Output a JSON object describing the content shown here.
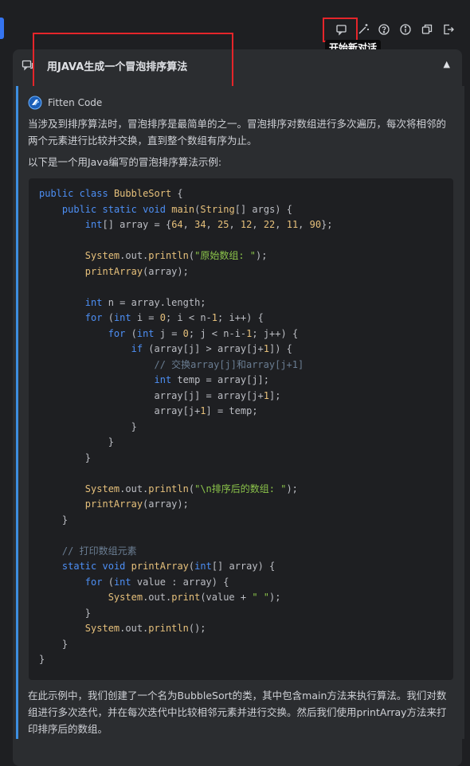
{
  "toolbar": {
    "icons": [
      "new-chat-icon",
      "magic-wand-icon",
      "help-icon",
      "info-icon",
      "copy-window-icon",
      "exit-icon"
    ],
    "tooltip": "开始新对话"
  },
  "panel": {
    "title": "用JAVA生成一个冒泡排序算法",
    "collapse_glyph": "▲"
  },
  "answer": {
    "author": "Fitten Code",
    "paragraph1": "当涉及到排序算法时，冒泡排序是最简单的之一。冒泡排序对数组进行多次遍历，每次将相邻的两个元素进行比较并交换，直到整个数组有序为止。",
    "paragraph2": "以下是一个用Java编写的冒泡排序算法示例:",
    "code": [
      "public class BubbleSort {",
      "    public static void main(String[] args) {",
      "        int[] array = {64, 34, 25, 12, 22, 11, 90};",
      "",
      "        System.out.println(\"原始数组: \");",
      "        printArray(array);",
      "",
      "        int n = array.length;",
      "        for (int i = 0; i < n-1; i++) {",
      "            for (int j = 0; j < n-i-1; j++) {",
      "                if (array[j] > array[j+1]) {",
      "                    // 交换array[j]和array[j+1]",
      "                    int temp = array[j];",
      "                    array[j] = array[j+1];",
      "                    array[j+1] = temp;",
      "                }",
      "            }",
      "        }",
      "",
      "        System.out.println(\"\\n排序后的数组: \");",
      "        printArray(array);",
      "    }",
      "",
      "    // 打印数组元素",
      "    static void printArray(int[] array) {",
      "        for (int value : array) {",
      "            System.out.print(value + \" \");",
      "        }",
      "        System.out.println();",
      "    }",
      "}"
    ],
    "paragraph3": "在此示例中，我们创建了一个名为BubbleSort的类，其中包含main方法来执行算法。我们对数组进行多次迭代，并在每次迭代中比较相邻元素并进行交换。然后我们使用printArray方法来打印排序后的数组。"
  },
  "colors": {
    "background": "#1e1f22",
    "panel": "#2b2d30",
    "accent": "#3d8ee0",
    "highlight": "#e5252a",
    "keyword": "#4d8ff5",
    "string": "#8bc34a",
    "number": "#e6c07b",
    "comment": "#6a7d92"
  }
}
